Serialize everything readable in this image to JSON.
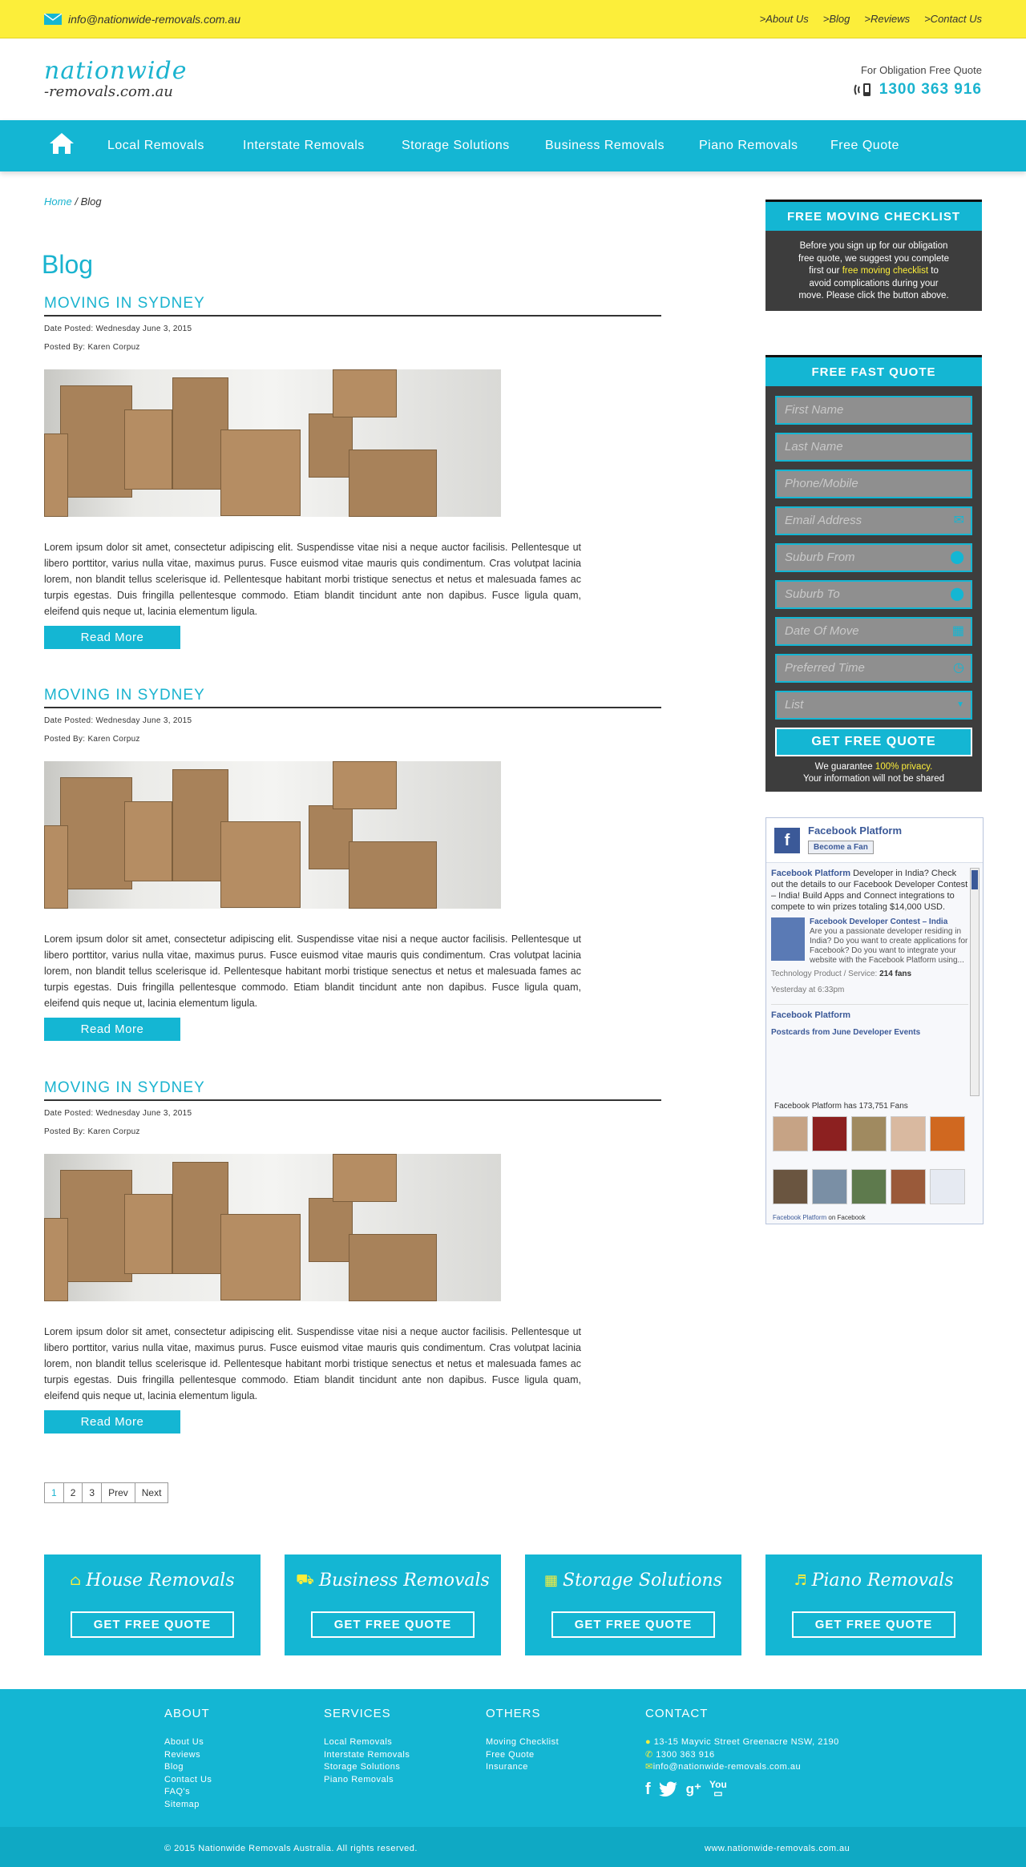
{
  "topbar": {
    "email": "info@nationwide-removals.com.au",
    "links": [
      ">About Us",
      ">Blog",
      ">Reviews",
      ">Contact Us"
    ]
  },
  "header": {
    "logo_line1": "nationwide",
    "logo_line2": "-removals.com.au",
    "quote_text": "For Obligation Free Quote",
    "phone": "1300 363 916"
  },
  "nav": {
    "items": [
      "Local Removals",
      "Interstate Removals",
      "Storage Solutions",
      "Business Removals",
      "Piano Removals",
      "Free Quote"
    ]
  },
  "breadcrumb": {
    "home": "Home",
    "sep": "/",
    "current": "Blog"
  },
  "page_title": "Blog",
  "posts": [
    {
      "title": "MOVING IN SYDNEY",
      "date": "Date Posted: Wednesday June 3, 2015",
      "author": "Posted By: Karen Corpuz",
      "body": "Lorem ipsum dolor sit amet, consectetur adipiscing elit. Suspendisse vitae nisi a neque auctor facilisis. Pellentesque ut libero porttitor, varius nulla vitae, maximus purus. Fusce euismod vitae mauris quis condimentum. Cras volutpat lacinia lorem, non blandit tellus scelerisque id. Pellentesque habitant morbi tristique senectus et netus et malesuada fames ac turpis egestas. Duis fringilla pellentesque commodo. Etiam blandit tincidunt ante non dapibus. Fusce ligula quam, eleifend quis neque ut, lacinia elementum ligula.",
      "read_more": "Read More"
    },
    {
      "title": "MOVING IN SYDNEY",
      "date": "Date Posted: Wednesday June 3, 2015",
      "author": "Posted By: Karen Corpuz",
      "body": "Lorem ipsum dolor sit amet, consectetur adipiscing elit. Suspendisse vitae nisi a neque auctor facilisis. Pellentesque ut libero porttitor, varius nulla vitae, maximus purus. Fusce euismod vitae mauris quis condimentum. Cras volutpat lacinia lorem, non blandit tellus scelerisque id. Pellentesque habitant morbi tristique senectus et netus et malesuada fames ac turpis egestas. Duis fringilla pellentesque commodo. Etiam blandit tincidunt ante non dapibus. Fusce ligula quam, eleifend quis neque ut, lacinia elementum ligula.",
      "read_more": "Read More"
    },
    {
      "title": "MOVING IN SYDNEY",
      "date": "Date Posted: Wednesday June 3, 2015",
      "author": "Posted By: Karen Corpuz",
      "body": "Lorem ipsum dolor sit amet, consectetur adipiscing elit. Suspendisse vitae nisi a neque auctor facilisis. Pellentesque ut libero porttitor, varius nulla vitae, maximus purus. Fusce euismod vitae mauris quis condimentum. Cras volutpat lacinia lorem, non blandit tellus scelerisque id. Pellentesque habitant morbi tristique senectus et netus et malesuada fames ac turpis egestas. Duis fringilla pellentesque commodo. Etiam blandit tincidunt ante non dapibus. Fusce ligula quam, eleifend quis neque ut, lacinia elementum ligula.",
      "read_more": "Read More"
    }
  ],
  "pager": {
    "pages": [
      "1",
      "2",
      "3"
    ],
    "prev": "Prev",
    "next": "Next"
  },
  "checklist": {
    "title": "FREE MOVING CHECKLIST",
    "text_a": "Before you sign up for our obligation free quote, we suggest you complete first our",
    "link": "free moving checklist",
    "text_b": "to avoid complications during your move. Please click the button above."
  },
  "quote_form": {
    "title": "FREE FAST QUOTE",
    "fields": [
      "First Name",
      "Last Name",
      "Phone/Mobile",
      "Email Address",
      "Suburb From",
      "Suburb To",
      "Date Of Move",
      "Preferred Time",
      "List"
    ],
    "submit": "GET FREE QUOTE",
    "guarantee_a": "We guarantee",
    "guarantee_hl": "100% privacy.",
    "guarantee_b": "Your information will not be shared"
  },
  "facebook": {
    "page_name": "Facebook Platform",
    "fan_button": "Become a Fan",
    "post1_name": "Facebook Platform",
    "post1_text": "Developer in India? Check out the details to our Facebook Developer Contest – India! Build Apps and Connect integrations to compete to win prizes totaling $14,000 USD.",
    "attach_title": "Facebook Developer Contest – India",
    "attach_text": "Are you a passionate developer residing in India? Do you want to create applications for Facebook? Do you want to integrate your website with the Facebook Platform using...",
    "attach_meta_label": "Technology Product / Service:",
    "attach_meta_value": "214 fans",
    "post1_time": "Yesterday at 6:33pm",
    "post2_name": "Facebook Platform",
    "post2_link": "Postcards from June Developer Events",
    "fans_text": "Facebook Platform has 173,751 Fans",
    "footer_link": "Facebook Platform",
    "footer_text": "on Facebook"
  },
  "promos": [
    {
      "title": "House Removals",
      "button": "GET FREE QUOTE"
    },
    {
      "title": "Business Removals",
      "button": "GET FREE QUOTE"
    },
    {
      "title": "Storage Solutions",
      "button": "GET FREE QUOTE"
    },
    {
      "title": "Piano Removals",
      "button": "GET FREE QUOTE"
    }
  ],
  "footer": {
    "about": {
      "title": "ABOUT",
      "items": [
        "About Us",
        "Reviews",
        "Blog",
        "Contact Us",
        "FAQ's",
        "Sitemap"
      ]
    },
    "services": {
      "title": "SERVICES",
      "items": [
        "Local Removals",
        "Interstate Removals",
        "Storage Solutions",
        "Piano Removals"
      ]
    },
    "others": {
      "title": "OTHERS",
      "items": [
        "Moving Checklist",
        "Free Quote",
        "Insurance"
      ]
    },
    "contact": {
      "title": "CONTACT",
      "address": "13-15 Mayvic Street Greenacre NSW, 2190",
      "phone": "1300 363 916",
      "email": "info@nationwide-removals.com.au"
    },
    "copyright": "© 2015 Nationwide Removals Australia. All rights reserved.",
    "site": "www.nationwide-removals.com.au"
  },
  "colors": {
    "accent": "#14b6d3",
    "topbar": "#fcee3a",
    "dark_panel": "#3d3d3d"
  }
}
